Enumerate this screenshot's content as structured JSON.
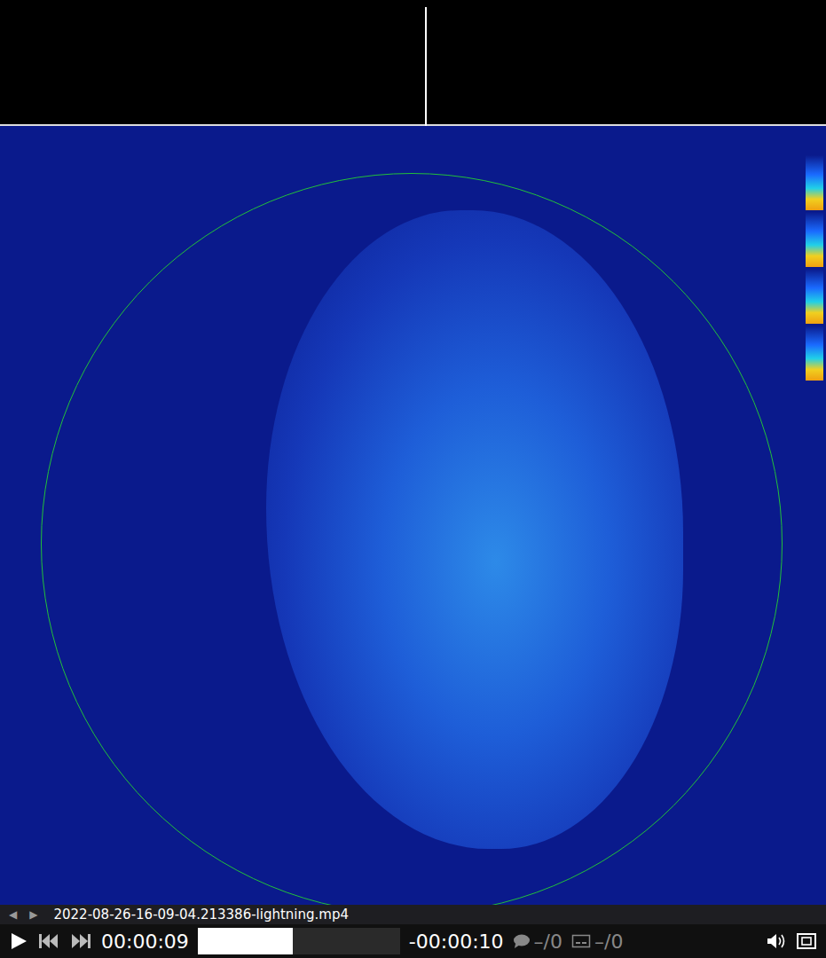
{
  "player": {
    "filename": "2022-08-26-16-09-04.213386-lightning.mp4",
    "playlist_prev": "◀",
    "playlist_next": "▶",
    "playing": false,
    "time_elapsed": "00:00:09",
    "time_remaining": "-00:00:10",
    "seek": {
      "level": 0.47
    },
    "tracks": [
      {
        "kind": "audio",
        "label": "–/0",
        "disabled": true
      },
      {
        "kind": "subtitle",
        "label": "–/0",
        "disabled": true
      }
    ]
  }
}
